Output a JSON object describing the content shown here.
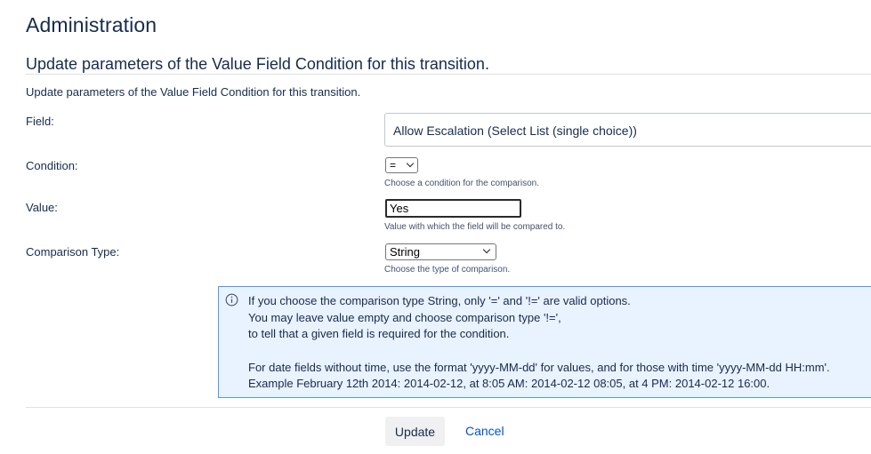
{
  "header": {
    "title": "Administration"
  },
  "form": {
    "heading": "Update parameters of the Value Field Condition for this transition.",
    "description": "Update parameters of the Value Field Condition for this transition.",
    "field": {
      "label": "Field:",
      "value": "Allow Escalation (Select List (single choice))"
    },
    "condition": {
      "label": "Condition:",
      "selected": "=",
      "help": "Choose a condition for the comparison."
    },
    "value": {
      "label": "Value:",
      "input_value": "Yes",
      "help": "Value with which the field will be compared to."
    },
    "comparison_type": {
      "label": "Comparison Type:",
      "selected": "String",
      "help": "Choose the type of comparison."
    }
  },
  "info": {
    "icon": "info-icon",
    "lines": [
      "If you choose the comparison type String, only '=' and '!=' are valid options.",
      "You may leave value empty and choose comparison type '!=',",
      "to tell that a given field is required for the condition.",
      "",
      "For date fields without time, use the format 'yyyy-MM-dd' for values, and for those with time 'yyyy-MM-dd HH:mm'.",
      "Example February 12th 2014: 2014-02-12, at 8:05 AM: 2014-02-12 08:05, at 4 PM: 2014-02-12 16:00."
    ]
  },
  "actions": {
    "update_label": "Update",
    "cancel_label": "Cancel"
  },
  "colors": {
    "text": "#172b4d",
    "link": "#0052cc",
    "info_background": "#e9f2ff",
    "info_border": "#4c9aff"
  }
}
